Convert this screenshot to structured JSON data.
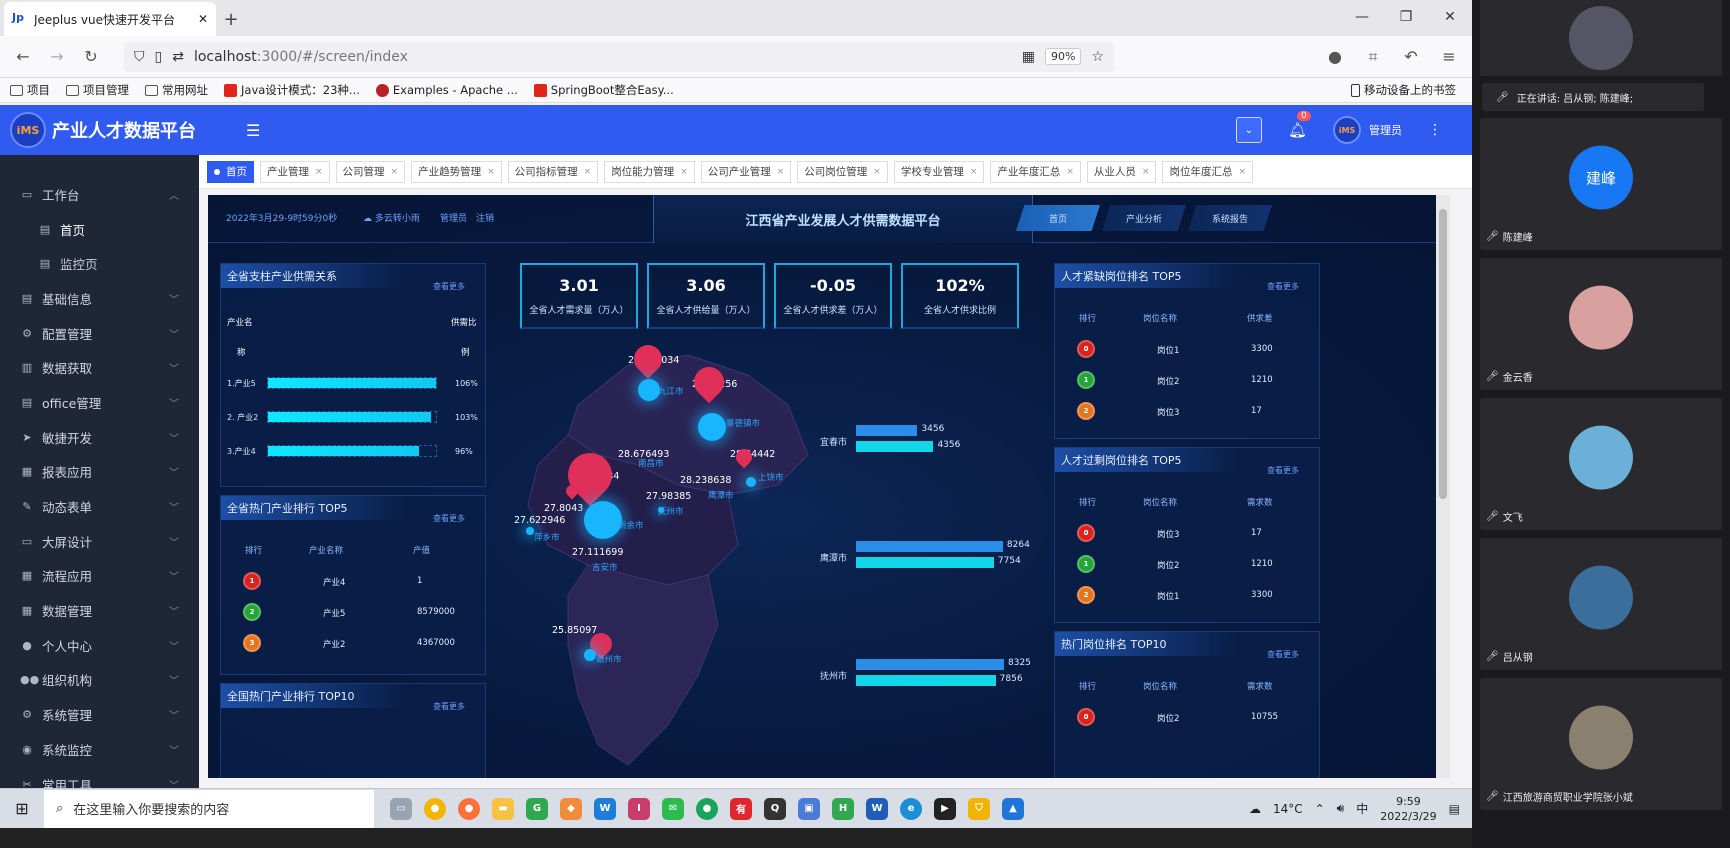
{
  "browser": {
    "tab_title": "Jeeplus vue快速开发平台",
    "url_host": "localhost",
    "url_path": ":3000/#/screen/index",
    "zoom": "90%",
    "bookmarks": [
      {
        "label": "项目",
        "kind": "folder"
      },
      {
        "label": "项目管理",
        "kind": "folder"
      },
      {
        "label": "常用网址",
        "kind": "folder"
      },
      {
        "label": "Java设计模式：23种...",
        "kind": "site",
        "color": "#e1251b"
      },
      {
        "label": "Examples - Apache ...",
        "kind": "site",
        "color": "#b8212a"
      },
      {
        "label": "SpringBoot整合Easy...",
        "kind": "site",
        "color": "#e1251b"
      }
    ],
    "bookmarks_right": "移动设备上的书签"
  },
  "app": {
    "logo_text": "iMS",
    "title": "产业人才数据平台",
    "bell_count": "0",
    "user_name": "管理员",
    "sidebar": [
      {
        "label": "工作台",
        "icon": "monitor-icon",
        "expanded": true
      },
      {
        "label": "首页",
        "icon": "doc-icon",
        "sub": true,
        "active": true
      },
      {
        "label": "监控页",
        "icon": "doc-icon",
        "sub": true
      },
      {
        "label": "基础信息",
        "icon": "doc-icon"
      },
      {
        "label": "配置管理",
        "icon": "gear-icon"
      },
      {
        "label": "数据获取",
        "icon": "bar-icon"
      },
      {
        "label": "office管理",
        "icon": "doc-icon"
      },
      {
        "label": "敏捷开发",
        "icon": "send-icon"
      },
      {
        "label": "报表应用",
        "icon": "chart-icon"
      },
      {
        "label": "动态表单",
        "icon": "edit-icon"
      },
      {
        "label": "大屏设计",
        "icon": "monitor-icon"
      },
      {
        "label": "流程应用",
        "icon": "grid-icon"
      },
      {
        "label": "数据管理",
        "icon": "table-icon"
      },
      {
        "label": "个人中心",
        "icon": "user-icon"
      },
      {
        "label": "组织机构",
        "icon": "users-icon"
      },
      {
        "label": "系统管理",
        "icon": "gears-icon"
      },
      {
        "label": "系统监控",
        "icon": "eye-icon"
      },
      {
        "label": "常用工具",
        "icon": "tool-icon"
      }
    ],
    "tags": [
      "首页",
      "产业管理",
      "公司管理",
      "产业趋势管理",
      "公司指标管理",
      "岗位能力管理",
      "公司产业管理",
      "公司岗位管理",
      "学校专业管理",
      "产业年度汇总",
      "从业人员",
      "岗位年度汇总"
    ]
  },
  "screen": {
    "datetime": "2022年3月29-9时59分0秒",
    "weather": "多云转小雨",
    "admin": "管理员",
    "logout": "注销",
    "title": "江西省产业发展人才供需数据平台",
    "nav": [
      "首页",
      "产业分析",
      "系统报告"
    ],
    "panel1": {
      "title": "全省支柱产业供需关系",
      "more": "查看更多",
      "col1": "产业名",
      "col1b": "称",
      "col2": "供需比",
      "col2b": "例",
      "rows": [
        {
          "name": "1.产业5",
          "pct": 1.0,
          "value": "106%"
        },
        {
          "name": "2. 产业2",
          "pct": 0.97,
          "value": "103%"
        },
        {
          "name": "3.产业4",
          "pct": 0.9,
          "value": "96%"
        }
      ]
    },
    "panel2": {
      "title": "全省热门产业排行 TOP5",
      "more": "查看更多",
      "headers": [
        "排行",
        "产业名称",
        "产值"
      ],
      "rows": [
        {
          "rank": "1",
          "name": "产业4",
          "value": "1",
          "color": "red"
        },
        {
          "rank": "2",
          "name": "产业5",
          "value": "8579000",
          "color": "green"
        },
        {
          "rank": "3",
          "name": "产业2",
          "value": "4367000",
          "color": "orange"
        }
      ]
    },
    "panel3": {
      "title": "全国热门产业排行 TOP10",
      "more": "查看更多"
    },
    "stats": [
      {
        "value": "3.01",
        "label": "全省人才需求量（万人）"
      },
      {
        "value": "3.06",
        "label": "全省人才供给量（万人）"
      },
      {
        "value": "-0.05",
        "label": "全省人才供求差（万人）"
      },
      {
        "value": "102%",
        "label": "全省人才供求比例"
      }
    ],
    "map": {
      "values": [
        "29.712034",
        "29.29256",
        "28.676493",
        "28.44442",
        "27.810834",
        "28.238638",
        "27.98385",
        "27.8043",
        "27.622946",
        "27.111699",
        "25.85097"
      ],
      "cities": [
        "九江市",
        "景德镇市",
        "南昌市",
        "上饶市",
        "鹰潭市",
        "抚州市",
        "新余市",
        "萍乡市",
        "吉安市",
        "赣州市"
      ]
    },
    "bars": [
      {
        "city": "宜春市",
        "v1": 3456,
        "v2": 4356
      },
      {
        "city": "鹰潭市",
        "v1": 8264,
        "v2": 7754
      },
      {
        "city": "抚州市",
        "v1": 8325,
        "v2": 7856
      }
    ],
    "panel4": {
      "title": "人才紧缺岗位排名 TOP5",
      "more": "查看更多",
      "headers": [
        "排行",
        "岗位名称",
        "供求差"
      ],
      "rows": [
        {
          "rank": "0",
          "name": "岗位1",
          "value": "3300",
          "color": "red"
        },
        {
          "rank": "1",
          "name": "岗位2",
          "value": "1210",
          "color": "green"
        },
        {
          "rank": "2",
          "name": "岗位3",
          "value": "17",
          "color": "orange"
        }
      ]
    },
    "panel5": {
      "title": "人才过剩岗位排名 TOP5",
      "more": "查看更多",
      "headers": [
        "排行",
        "岗位名称",
        "需求数"
      ],
      "rows": [
        {
          "rank": "0",
          "name": "岗位3",
          "value": "17",
          "color": "red"
        },
        {
          "rank": "1",
          "name": "岗位2",
          "value": "1210",
          "color": "green"
        },
        {
          "rank": "2",
          "name": "岗位1",
          "value": "3300",
          "color": "orange"
        }
      ]
    },
    "panel6": {
      "title": "热门岗位排名 TOP10",
      "more": "查看更多",
      "headers": [
        "排行",
        "岗位名称",
        "需求数"
      ],
      "rows": [
        {
          "rank": "0",
          "name": "岗位2",
          "value": "10755",
          "color": "red"
        }
      ]
    }
  },
  "taskbar": {
    "search_placeholder": "在这里输入你要搜索的内容",
    "weather": "14°C",
    "time": "9:59",
    "date": "2022/3/29"
  },
  "meeting": {
    "speaking": "正在讲话: 吕从钢; 陈建峰;",
    "participants": [
      {
        "name": "",
        "avatar": "photo"
      },
      {
        "name": "陈建峰",
        "avatar_text": "建峰"
      },
      {
        "name": "金云香",
        "avatar": "photo"
      },
      {
        "name": "文飞",
        "avatar": "cartoon"
      },
      {
        "name": "吕从钢",
        "avatar": "photo"
      },
      {
        "name": "江西旅游商贸职业学院张小斌",
        "avatar": "photo"
      }
    ]
  }
}
